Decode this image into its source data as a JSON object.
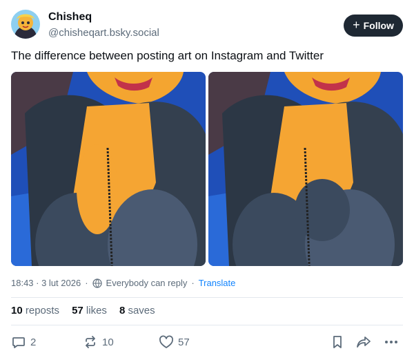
{
  "author": {
    "name": "Chisheq",
    "handle": "@chisheqart.bsky.social"
  },
  "follow_label": "Follow",
  "post": {
    "text": "The difference between posting art on Instagram and Twitter"
  },
  "images": [
    {
      "alt": ""
    },
    {
      "alt": ""
    }
  ],
  "meta": {
    "time": "18:43 · 3 lut 2026",
    "separator": "·",
    "reply_setting": "Everybody can reply",
    "translate": "Translate"
  },
  "stats": {
    "reposts_count": "10",
    "reposts_label": "reposts",
    "likes_count": "57",
    "likes_label": "likes",
    "saves_count": "8",
    "saves_label": "saves"
  },
  "actions": {
    "reply_count": "2",
    "repost_count": "10",
    "like_count": "57"
  },
  "colors": {
    "accent": "#1083fe",
    "follow_bg": "#1e2833",
    "muted_text": "#5c6b7a"
  }
}
